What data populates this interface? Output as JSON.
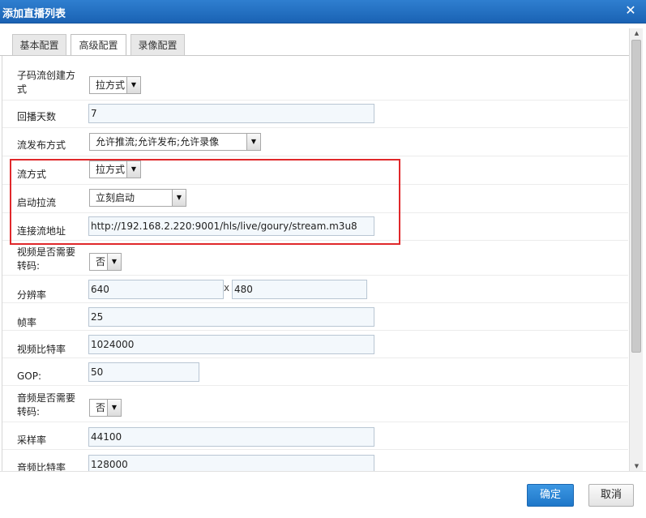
{
  "dialog": {
    "title": "添加直播列表"
  },
  "tabs": [
    {
      "label": "基本配置",
      "active": false
    },
    {
      "label": "高级配置",
      "active": true
    },
    {
      "label": "录像配置",
      "active": false
    }
  ],
  "form": {
    "substream_mode": {
      "label": "子码流创建方式",
      "value": "拉方式"
    },
    "replay_days": {
      "label": "回播天数",
      "value": "7"
    },
    "publish_mode": {
      "label": "流发布方式",
      "value": "允许推流;允许发布;允许录像"
    },
    "stream_mode": {
      "label": "流方式",
      "value": "拉方式"
    },
    "start_pull": {
      "label": "启动拉流",
      "value": "立刻启动"
    },
    "stream_url": {
      "label": "连接流地址",
      "value": "http://192.168.2.220:9001/hls/live/goury/stream.m3u8"
    },
    "video_transcode": {
      "label": "视频是否需要转码:",
      "value": "否"
    },
    "resolution": {
      "label": "分辨率",
      "width": "640",
      "separator": "x",
      "height": "480"
    },
    "framerate": {
      "label": "帧率",
      "value": "25"
    },
    "video_bitrate": {
      "label": "视频比特率",
      "value": "1024000"
    },
    "gop": {
      "label": "GOP:",
      "value": "50"
    },
    "audio_transcode": {
      "label": "音频是否需要转码:",
      "value": "否"
    },
    "sample_rate": {
      "label": "采样率",
      "value": "44100"
    },
    "audio_bitrate": {
      "label": "音频比特率",
      "value": "128000"
    }
  },
  "footer": {
    "ok_label": "确定",
    "cancel_label": "取消"
  },
  "colors": {
    "titlebar": "#1a62b4",
    "highlight": "#e0282b",
    "primary_button": "#1f77c9"
  }
}
